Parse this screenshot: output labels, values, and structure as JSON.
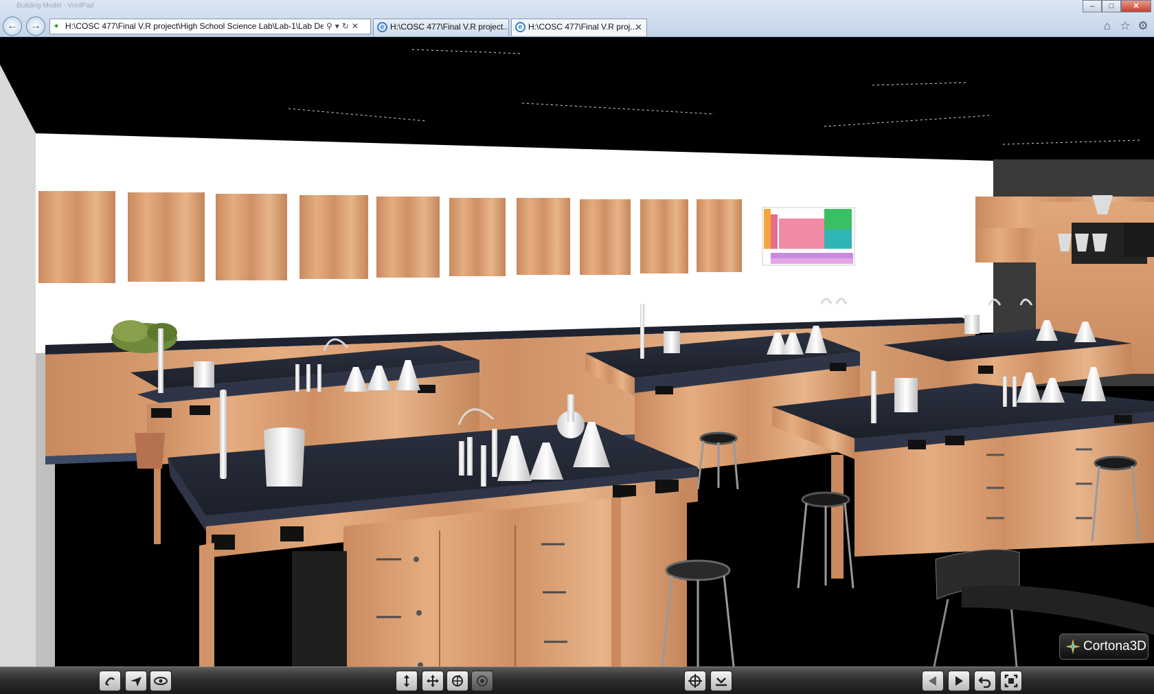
{
  "browser": {
    "window_title": "Building Model - VrmlPad",
    "address": "H:\\COSC 477\\Final V.R project\\High School Science Lab\\Lab-1\\Lab De",
    "tabs": [
      {
        "label": "H:\\COSC 477\\Final V.R project...",
        "active": false
      },
      {
        "label": "H:\\COSC 477\\Final V.R proj...",
        "active": true
      }
    ],
    "window_buttons": {
      "minimize": "–",
      "maximize": "□",
      "close": "✕"
    },
    "icons": [
      "back-arrow-icon",
      "forward-arrow-icon",
      "search-icon",
      "refresh-icon",
      "stop-icon",
      "home-icon",
      "favorites-star-icon",
      "gear-icon"
    ]
  },
  "viewer": {
    "logo_text": "Cortona3D",
    "toolbar_groups": {
      "left": [
        "walk-mode",
        "fly-mode",
        "study-mode"
      ],
      "center": [
        "plan-mode",
        "pan-mode",
        "turn-mode",
        "roll-mode"
      ],
      "right": [
        "goto-mode",
        "align-mode"
      ],
      "far_right": [
        "previous-viewpoint",
        "next-viewpoint",
        "restore-viewpoint",
        "fit-to-window"
      ]
    }
  },
  "colors": {
    "wood": "#d89a6e",
    "countertop": "#22262e",
    "wall": "#ffffff",
    "ceiling": "#000000",
    "chrome_bg": "#d3dfee",
    "toolbar_bg": "#2e2e2e"
  }
}
